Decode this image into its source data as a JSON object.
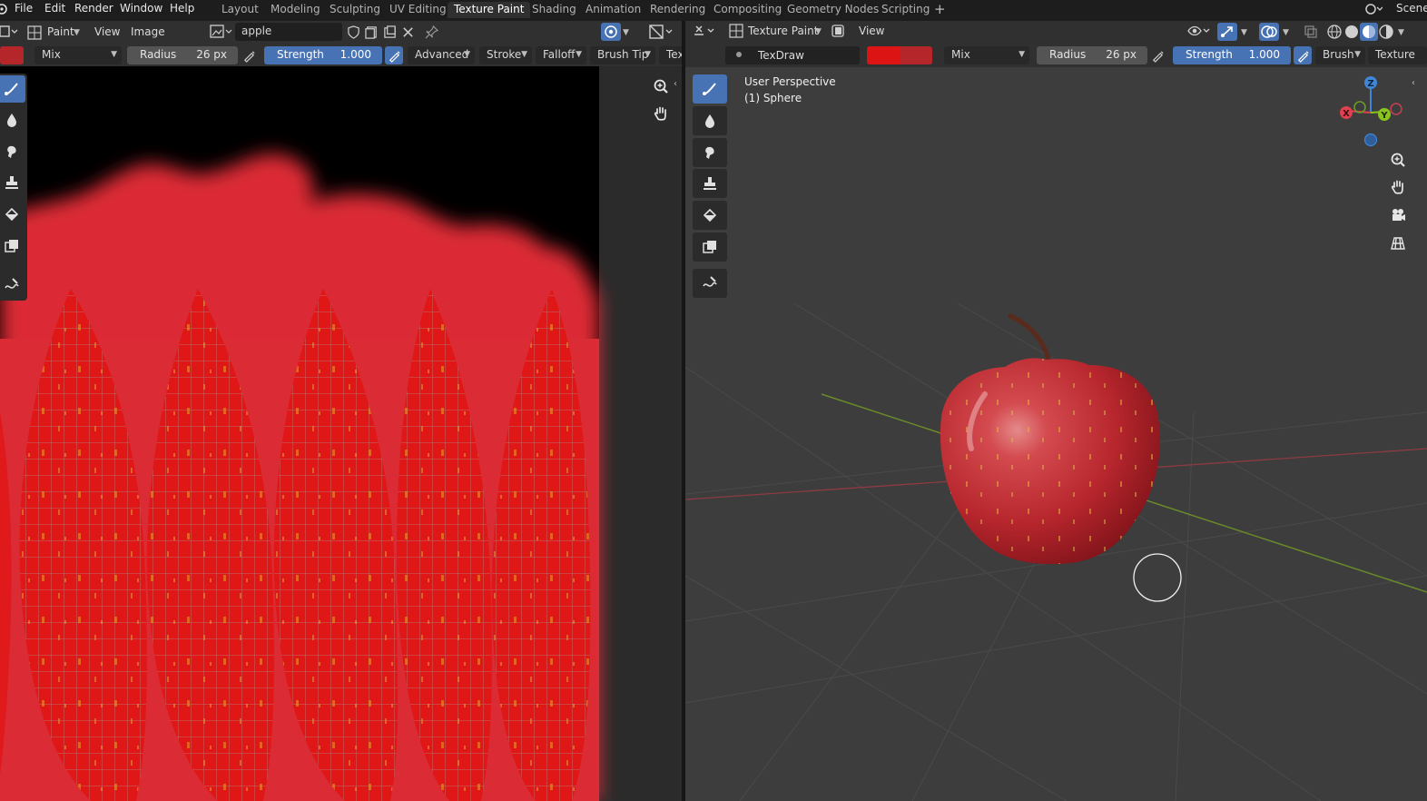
{
  "menu": [
    "File",
    "Edit",
    "Render",
    "Window",
    "Help"
  ],
  "workspaces": {
    "tabs": [
      "Layout",
      "Modeling",
      "Sculpting",
      "UV Editing",
      "Texture Paint",
      "Shading",
      "Animation",
      "Rendering",
      "Compositing",
      "Geometry Nodes",
      "Scripting"
    ],
    "active": "Texture Paint"
  },
  "scene_label": "Scene",
  "image_editor": {
    "mode": "Paint",
    "menus": [
      "View",
      "Image"
    ],
    "image_name": "apple",
    "tool_settings": {
      "blend": "Mix",
      "radius_label": "Radius",
      "radius_value": "26 px",
      "strength_label": "Strength",
      "strength_value": "1.000",
      "panels": [
        "Advanced",
        "Stroke",
        "Falloff",
        "Brush Tip",
        "Tex"
      ]
    }
  },
  "viewport": {
    "mode": "Texture Paint",
    "menus": [
      "View"
    ],
    "brush_name": "TexDraw",
    "tool_settings": {
      "blend": "Mix",
      "radius_label": "Radius",
      "radius_value": "26 px",
      "strength_label": "Strength",
      "strength_value": "1.000",
      "panels": [
        "Brush",
        "Texture"
      ]
    },
    "overlay_text": {
      "perspective": "User Perspective",
      "object": "(1) Sphere"
    },
    "gizmo_axes": [
      "Z",
      "X",
      "Y"
    ]
  },
  "colors": {
    "active_blue": "#4772b3",
    "paint_red": "#dd1414",
    "paint_red_secondary": "#b5262a",
    "texture_red": "#db2b35",
    "apple_red": "#c7333a",
    "axis_x": "#e0404f",
    "axis_y": "#8ac41e",
    "axis_z": "#3f86d6"
  },
  "icons": {
    "tools": [
      "brush-draw-icon",
      "brush-soften-icon",
      "brush-smear-icon",
      "brush-clone-icon",
      "brush-fill-icon",
      "brush-mask-icon",
      "annotate-icon"
    ],
    "nav": [
      "zoom-icon",
      "hand-pan-icon",
      "camera-icon",
      "grid-view-icon"
    ]
  }
}
